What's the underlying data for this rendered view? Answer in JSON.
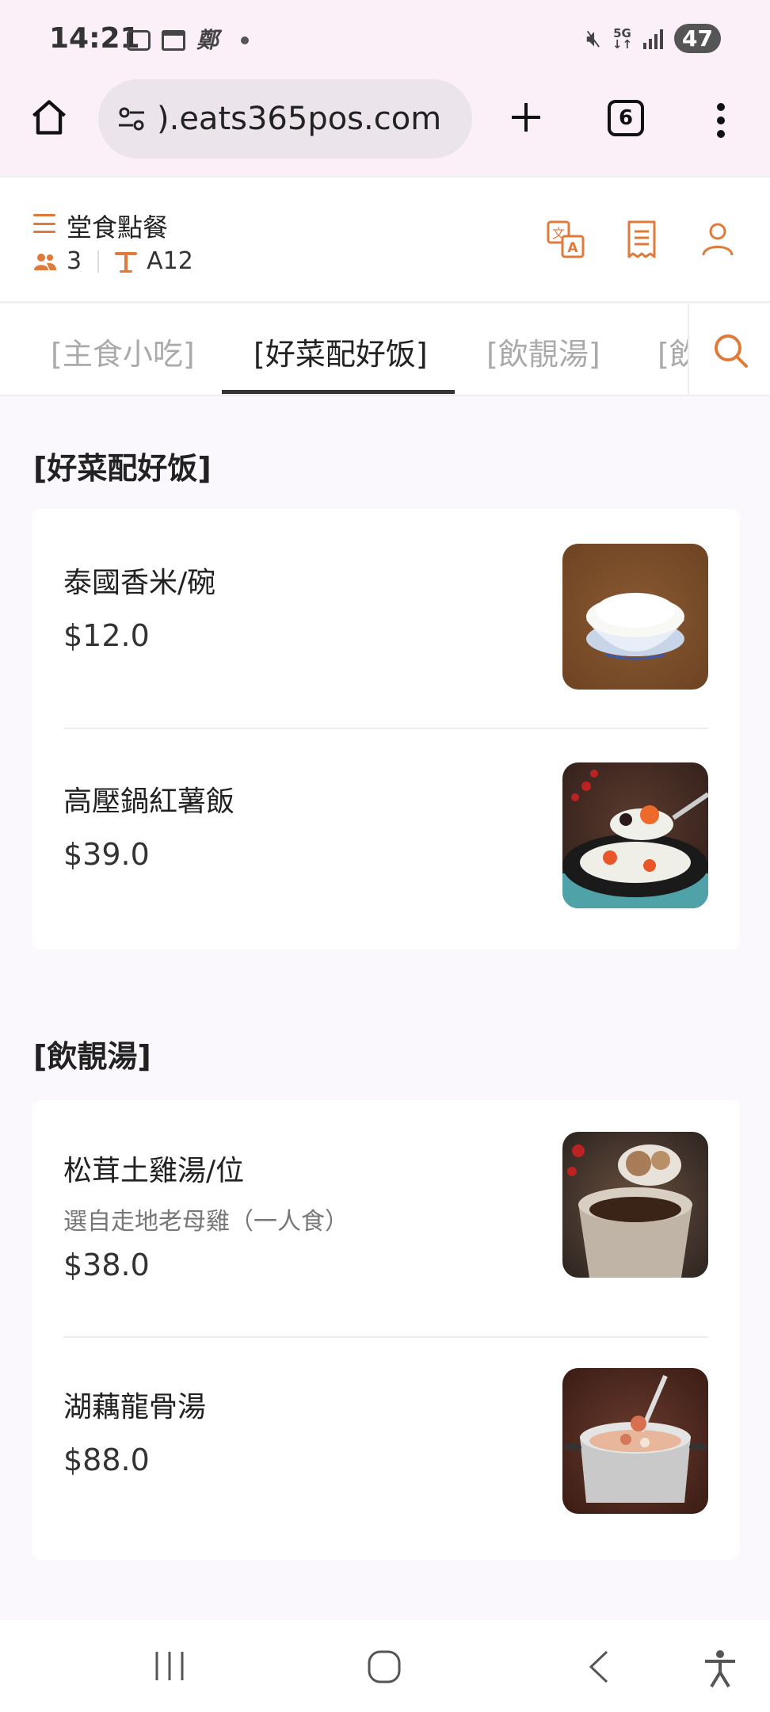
{
  "status_bar": {
    "time": "14:21",
    "notification_text_icon": "鄭",
    "network": "5G",
    "battery": "47",
    "icons": [
      "screenshot-icon",
      "calendar-icon",
      "mute-icon",
      "signal-icon"
    ]
  },
  "browser": {
    "url": ").eats365pos.com",
    "tab_count": "6"
  },
  "header": {
    "mode_label": "堂食點餐",
    "guests": "3",
    "table": "A12",
    "accent_color": "#e07a3a"
  },
  "category_tabs": [
    {
      "label": "[主食小吃]"
    },
    {
      "label": "[好菜配好饭]"
    },
    {
      "label": "[飲靚湯]"
    },
    {
      "label": "[飲"
    }
  ],
  "sections": [
    {
      "title": "[好菜配好饭]",
      "items": [
        {
          "name": "泰國香米/碗",
          "price": "$12.0"
        },
        {
          "name": "高壓鍋紅薯飯",
          "price": "$39.0"
        }
      ]
    },
    {
      "title": "[飲靚湯]",
      "items": [
        {
          "name": "松茸土雞湯/位",
          "description": "選自走地老母雞（一人食）",
          "price": "$38.0"
        },
        {
          "name": "湖藕龍骨湯",
          "price": "$88.0"
        }
      ]
    }
  ]
}
